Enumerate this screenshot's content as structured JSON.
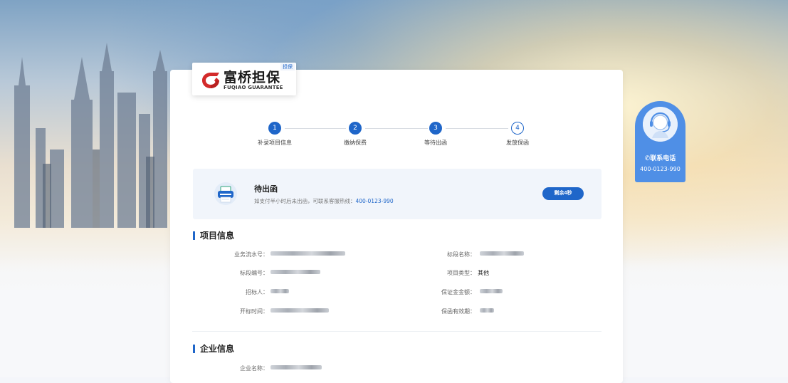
{
  "brand": {
    "tag": "担保",
    "name_cn": "富桥担保",
    "name_en": "FUQIAO GUARANTEE"
  },
  "steps": [
    {
      "number": "1",
      "label": "补录项目信息",
      "state": "done"
    },
    {
      "number": "2",
      "label": "缴纳保费",
      "state": "done"
    },
    {
      "number": "3",
      "label": "等待出函",
      "state": "current"
    },
    {
      "number": "4",
      "label": "发放保函",
      "state": "todo"
    }
  ],
  "status": {
    "title": "待出函",
    "desc_prefix": "如支付半小时后未出函，可联系客服热线：",
    "hotline": "400-0123-990",
    "countdown_label": "剩余4秒"
  },
  "project_section": {
    "title": "项目信息",
    "fields": [
      {
        "label": "业务流水号：",
        "value": ""
      },
      {
        "label": "标段名称：",
        "value": ""
      },
      {
        "label": "标段编号：",
        "value": ""
      },
      {
        "label": "项目类型：",
        "value": "其他"
      },
      {
        "label": "招标人：",
        "value": ""
      },
      {
        "label": "保证金金额：",
        "value": ""
      },
      {
        "label": "开标时间：",
        "value": ""
      },
      {
        "label": "保函有效期：",
        "value": ""
      }
    ]
  },
  "company_section": {
    "title": "企业信息",
    "fields": [
      {
        "label": "企业名称：",
        "value": ""
      }
    ]
  },
  "contact": {
    "label": "✆联系电话",
    "phone": "400-0123-990"
  },
  "colors": {
    "accent": "#1f66c9",
    "contact_bg": "#4f8fe6"
  }
}
